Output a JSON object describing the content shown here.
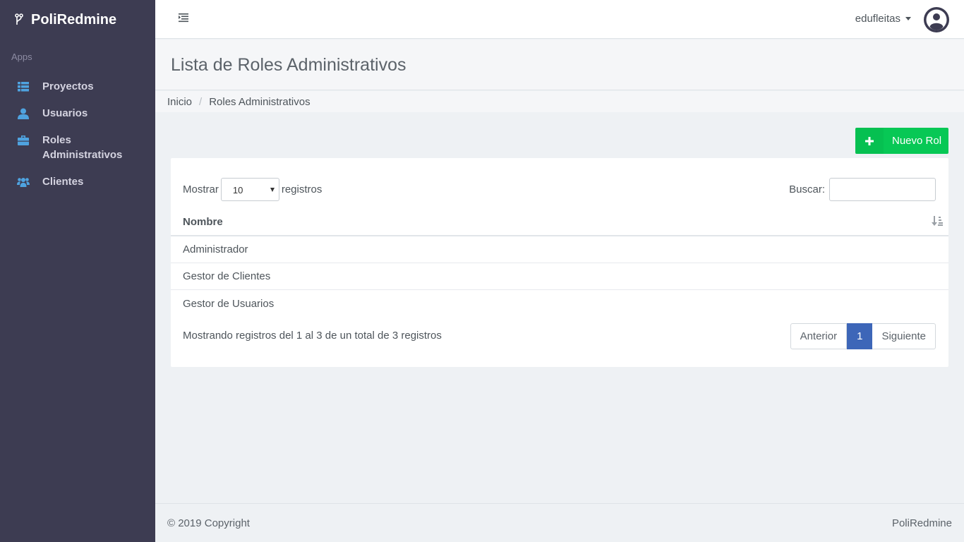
{
  "app": {
    "name": "PoliRedmine"
  },
  "sidebar": {
    "section": "Apps",
    "items": [
      {
        "icon": "list-icon",
        "label": "Proyectos"
      },
      {
        "icon": "user-icon",
        "label": "Usuarios"
      },
      {
        "icon": "briefcase-icon",
        "label": "Roles Administrativos"
      },
      {
        "icon": "users-icon",
        "label": "Clientes"
      }
    ]
  },
  "topbar": {
    "username": "edufleitas"
  },
  "page": {
    "title": "Lista de Roles Administrativos",
    "breadcrumb": [
      "Inicio",
      "Roles Administrativos"
    ]
  },
  "actions": {
    "new_label": "Nuevo Rol"
  },
  "table": {
    "length_prefix": "Mostrar",
    "length_value": "10",
    "length_suffix": "registros",
    "search_label": "Buscar:",
    "search_value": "",
    "column": "Nombre",
    "rows": [
      "Administrador",
      "Gestor de Clientes",
      "Gestor de Usuarios"
    ],
    "info": "Mostrando registros del 1 al 3 de un total de 3 registros"
  },
  "pagination": {
    "prev": "Anterior",
    "current": "1",
    "next": "Siguiente"
  },
  "footer": {
    "copyright": "© 2019 Copyright",
    "brand": "PoliRedmine"
  },
  "colors": {
    "sidebar": "#3d3c52",
    "accent_icon": "#4fa3e0",
    "new_button": "#07c855",
    "active_page": "#3d66b8"
  }
}
